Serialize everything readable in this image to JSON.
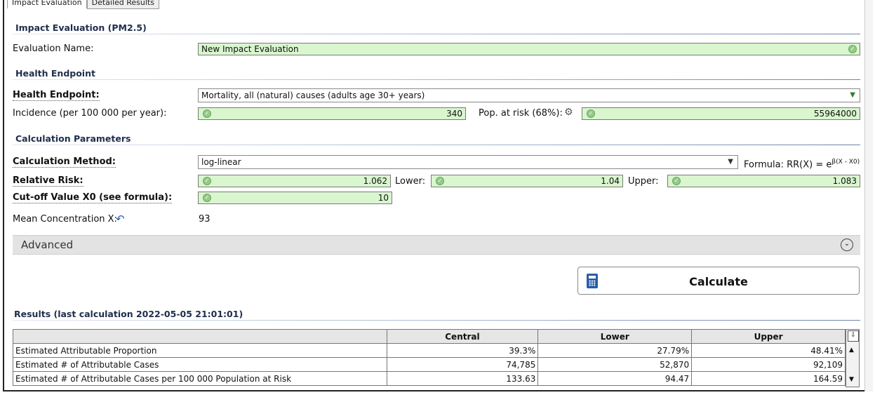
{
  "tabs": [
    "Impact Evaluation",
    "Detailed Results"
  ],
  "sections": {
    "impact": "Impact Evaluation (PM2.5)",
    "health": "Health Endpoint",
    "calc": "Calculation Parameters",
    "results": "Results (last calculation 2022-05-05 21:01:01)"
  },
  "evaluation": {
    "label": "Evaluation Name:",
    "value": "New Impact Evaluation"
  },
  "health_endpoint": {
    "label": "Health Endpoint:",
    "value": "Mortality, all (natural) causes (adults age 30+ years)",
    "incidence_label": "Incidence (per 100 000 per year):",
    "incidence_value": "340",
    "pop_label": "Pop. at risk (68%):",
    "pop_value": "55964000"
  },
  "calc_params": {
    "method_label": "Calculation Method:",
    "method_value": "log-linear",
    "formula": "Formula: RR(X) = e",
    "formula_exp": "β(X - X0)",
    "rr_label": "Relative Risk:",
    "rr_value": "1.062",
    "lower_label": "Lower:",
    "lower_value": "1.04",
    "upper_label": "Upper:",
    "upper_value": "1.083",
    "cutoff_label": "Cut-off Value X0 (see formula):",
    "cutoff_value": "10",
    "mean_label": "Mean Concentration X:",
    "mean_value": "93"
  },
  "advanced_label": "Advanced",
  "calculate_label": "Calculate",
  "results": {
    "headers": [
      "",
      "Central",
      "Lower",
      "Upper"
    ],
    "rows": [
      [
        "Estimated Attributable Proportion",
        "39.3%",
        "27.79%",
        "48.41%"
      ],
      [
        "Estimated # of Attributable Cases",
        "74,785",
        "52,870",
        "92,109"
      ],
      [
        "Estimated # of Attributable Cases per 100 000 Population at Risk",
        "133.63",
        "94.47",
        "164.59"
      ]
    ]
  },
  "colors": {
    "field_bg": "#d9f6cf",
    "section_text": "#1f2d4d",
    "calc_icon": "#2a5da8"
  }
}
